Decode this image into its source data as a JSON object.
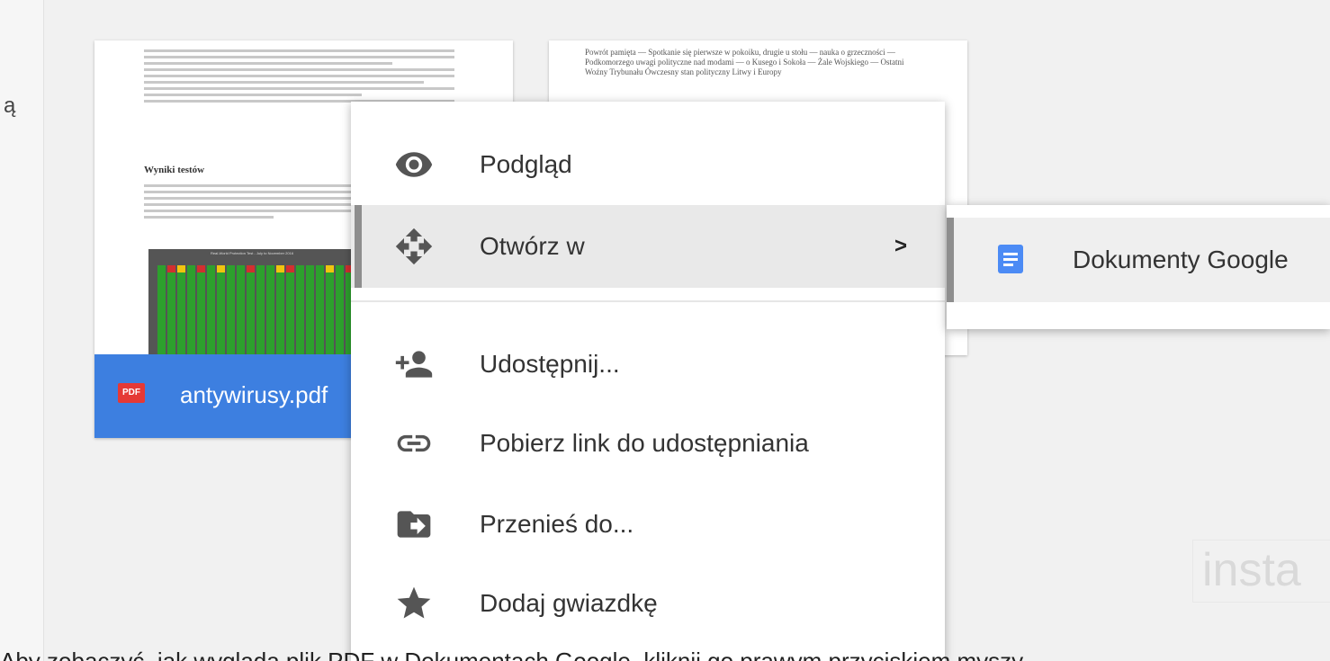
{
  "left_panel": {
    "glyph": "ą"
  },
  "file_card": {
    "file_name": "antywirusy.pdf",
    "badge": "PDF",
    "heading": "Wyniki testów",
    "chart_title": "Real-World Protection Test - July to November 2016"
  },
  "card2_text": "Powrót pamięta — Spotkanie się pierwsze w pokoiku, drugie u stołu — nauka o grzeczności — Podkomorzego uwagi polityczne nad modami — o Kusego i Sokoła — Żale Wojskiego — Ostatni Woźny Trybunału Ówczesny stan polityczny Litwy i Europy",
  "context_menu": {
    "items": [
      {
        "label": "Podgląd",
        "icon": "eye-icon"
      },
      {
        "label": "Otwórz w",
        "icon": "move-arrows-icon",
        "chevron": ">"
      },
      {
        "label": "Udostępnij...",
        "icon": "add-person-icon"
      },
      {
        "label": "Pobierz link do udostępniania",
        "icon": "link-icon"
      },
      {
        "label": "Przenieś do...",
        "icon": "folder-move-icon"
      },
      {
        "label": "Dodaj gwiazdkę",
        "icon": "star-icon"
      }
    ]
  },
  "submenu": {
    "item": {
      "label": "Dokumenty Google",
      "icon": "google-docs-icon"
    }
  },
  "watermark": "insta",
  "caption": "Aby zobaczyć, jak wygląda plik PDF w Dokumentach Google, kliknij go prawym przyciskiem myszy"
}
